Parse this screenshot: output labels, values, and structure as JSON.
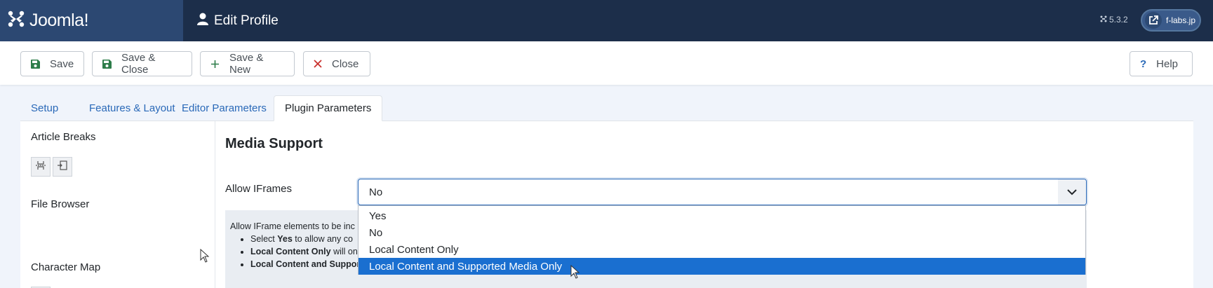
{
  "header": {
    "brand_name": "Joomla!",
    "page_title": "Edit Profile",
    "version": "5.3.2",
    "site_label": "f-labs.jp"
  },
  "toolbar": {
    "save": "Save",
    "save_close": "Save & Close",
    "save_new": "Save & New",
    "close": "Close",
    "help": "Help"
  },
  "tabs": [
    {
      "label": "Setup",
      "active": false
    },
    {
      "label": "Features & Layout",
      "active": false
    },
    {
      "label": "Editor Parameters",
      "active": false
    },
    {
      "label": "Plugin Parameters",
      "active": true
    }
  ],
  "sidebar": {
    "article_breaks": "Article Breaks",
    "file_browser": "File Browser",
    "character_map": "Character Map"
  },
  "main": {
    "section_title": "Media Support",
    "field_label": "Allow IFrames",
    "selected_value": "No",
    "description": {
      "intro": "Allow IFrame elements to be inc",
      "items": [
        {
          "bold": "",
          "pre": "Select ",
          "strong": "Yes",
          "rest": " to allow any co"
        },
        {
          "strong": "Local Content Only",
          "rest": " will on"
        },
        {
          "strong": "Local Content and Suppor",
          "rest": ""
        }
      ]
    },
    "options": [
      {
        "label": "Yes",
        "selected": false
      },
      {
        "label": "No",
        "selected": false
      },
      {
        "label": "Local Content Only",
        "selected": false
      },
      {
        "label": "Local Content and Supported Media Only",
        "selected": true
      }
    ]
  },
  "colors": {
    "header_bg": "#1c2e4a",
    "brand_bg": "#2c4872",
    "link": "#2a69b8",
    "highlight": "#1a6fd0"
  }
}
